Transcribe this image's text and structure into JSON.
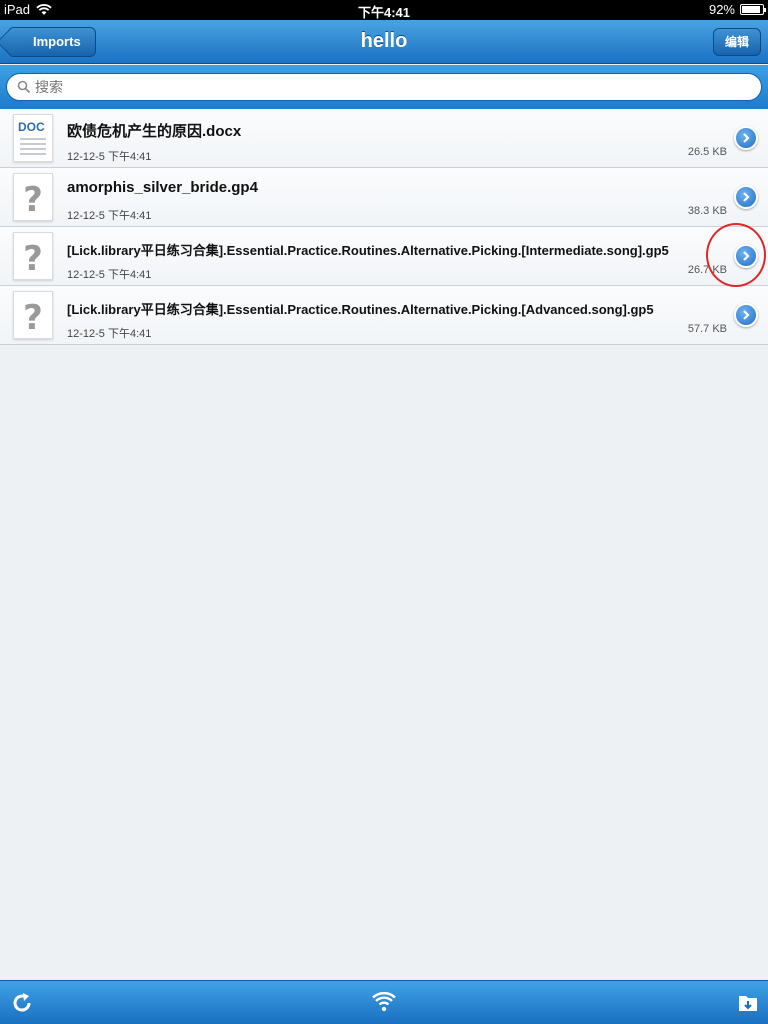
{
  "status_bar": {
    "device": "iPad",
    "time": "下午4:41",
    "battery": "92%",
    "battery_level": 0.92
  },
  "nav": {
    "back_label": "Imports",
    "title": "hello",
    "edit_label": "编辑"
  },
  "search": {
    "placeholder": "搜索"
  },
  "files": [
    {
      "name": "欧债危机产生的原因.docx",
      "date": "12-12-5 下午4:41",
      "size": "26.5 KB",
      "icon": "doc-file-icon",
      "thumb_label": "DOC"
    },
    {
      "name": "amorphis_silver_bride.gp4",
      "date": "12-12-5 下午4:41",
      "size": "38.3 KB",
      "icon": "unknown-file-icon"
    },
    {
      "name": "[Lick.library平日练习合集].Essential.Practice.Routines.Alternative.Picking.[Intermediate.song].gp5",
      "date": "12-12-5 下午4:41",
      "size": "26.7 KB",
      "icon": "unknown-file-icon"
    },
    {
      "name": "[Lick.library平日练习合集].Essential.Practice.Routines.Alternative.Picking.[Advanced.song].gp5",
      "date": "12-12-5 下午4:41",
      "size": "57.7 KB",
      "icon": "unknown-file-icon"
    }
  ],
  "toolbar": {
    "refresh_icon": "refresh-icon",
    "wifi_icon": "wifi-icon",
    "folder_icon": "folder-import-icon"
  },
  "colors": {
    "nav_blue": "#1a72c4",
    "annotation_red": "#e0262a"
  }
}
